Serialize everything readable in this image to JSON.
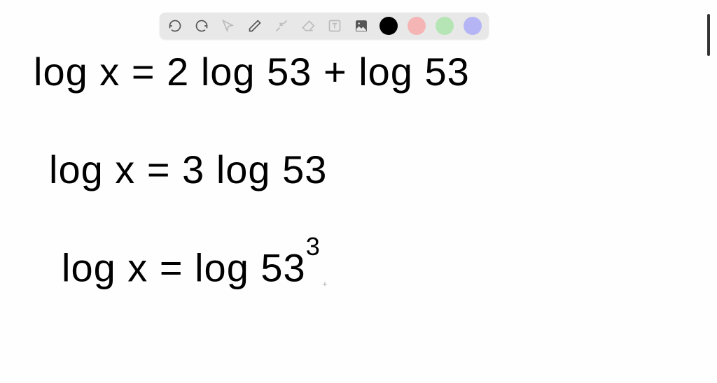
{
  "toolbar": {
    "buttons": [
      {
        "name": "undo",
        "icon": "undo-icon",
        "interactable": true
      },
      {
        "name": "redo",
        "icon": "redo-icon",
        "interactable": true
      },
      {
        "name": "pointer",
        "icon": "pointer-icon",
        "interactable": true,
        "disabled": true
      },
      {
        "name": "pen",
        "icon": "pen-icon",
        "interactable": true
      },
      {
        "name": "tools",
        "icon": "tools-icon",
        "interactable": true,
        "disabled": true
      },
      {
        "name": "eraser",
        "icon": "eraser-icon",
        "interactable": true,
        "disabled": true
      },
      {
        "name": "text",
        "icon": "text-icon",
        "interactable": true,
        "disabled": true
      },
      {
        "name": "image",
        "icon": "image-icon",
        "interactable": true
      }
    ],
    "colors": [
      {
        "name": "black",
        "hex": "#000000",
        "active": true
      },
      {
        "name": "pink",
        "hex": "#f5b5b5",
        "active": false
      },
      {
        "name": "green",
        "hex": "#b5e5b5",
        "active": false
      },
      {
        "name": "purple",
        "hex": "#b5b5f5",
        "active": false
      }
    ]
  },
  "equations": {
    "line1": "log x = 2 log 53 + log 53",
    "line2": "log x = 3 log 53",
    "line3_base": "log x = log 53",
    "line3_exp": "3"
  },
  "cursor_mark": "+"
}
